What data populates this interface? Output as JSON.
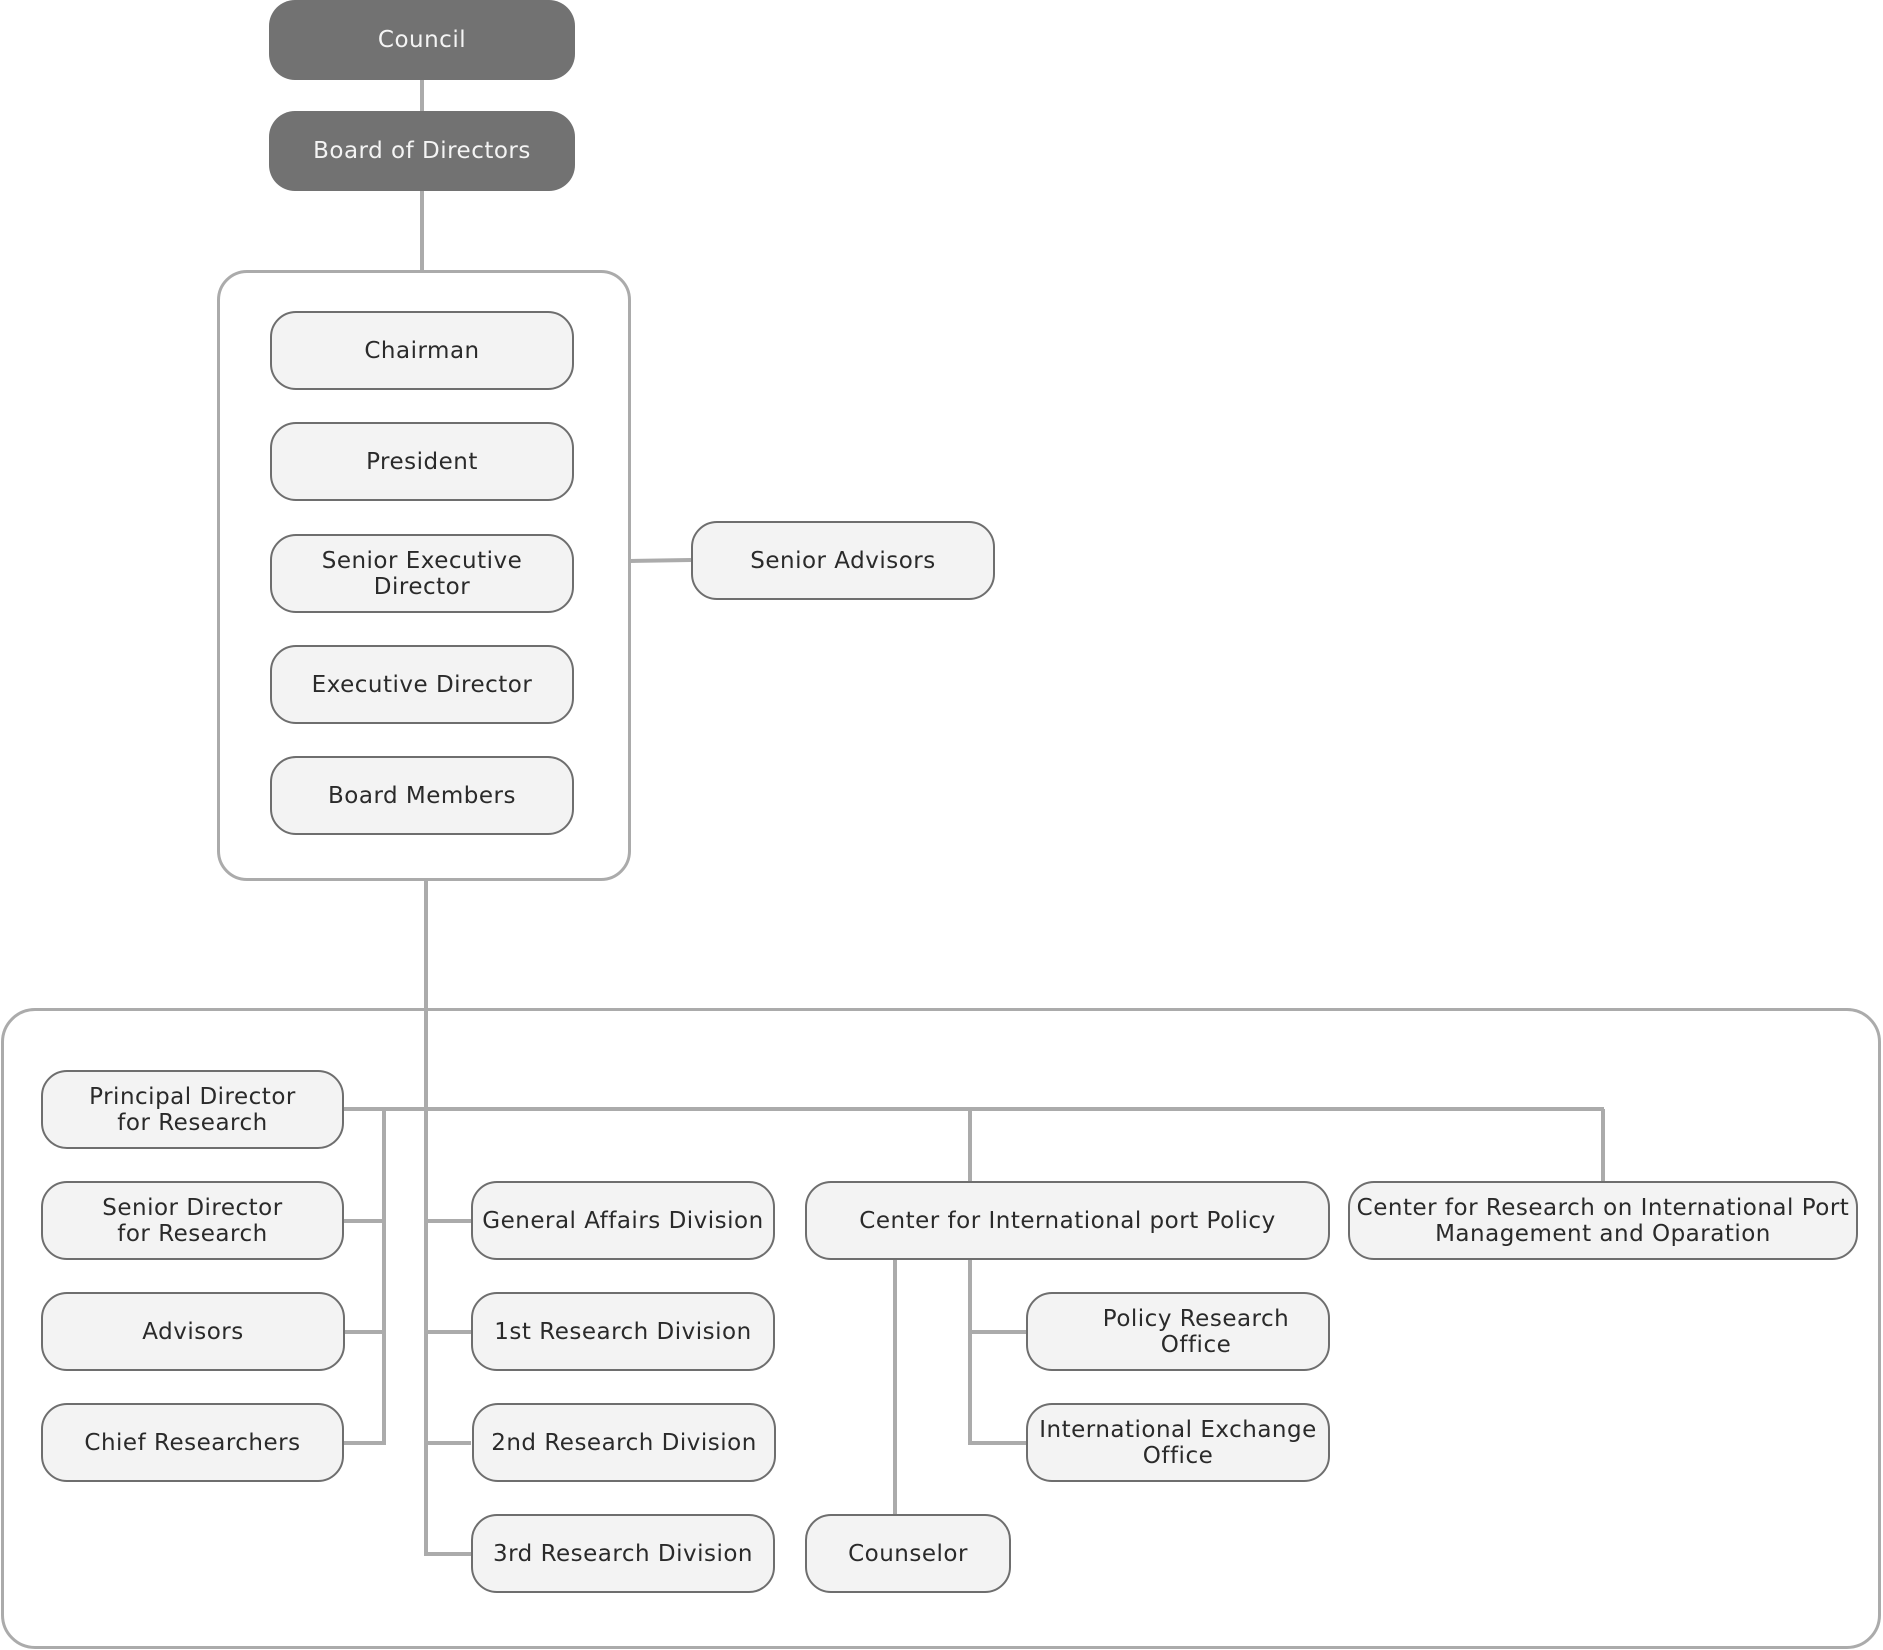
{
  "diagram": {
    "type": "organization-chart",
    "colors": {
      "top_node_fill": "#727272",
      "top_node_text": "#f4f4f4",
      "node_fill": "#f3f3f3",
      "node_border": "#6e6e6e",
      "connector": "#ababab",
      "text": "#2a2a2a"
    },
    "governance": {
      "council": "Council",
      "board_of_directors": "Board of Directors"
    },
    "executives": [
      "Chairman",
      "President",
      "Senior Executive Director",
      "Executive Director",
      "Board Members"
    ],
    "senior_advisors": "Senior Advisors",
    "research_leadership": [
      "Principal Director\nfor Research",
      "Senior Director\nfor Research",
      "Advisors",
      "Chief Researchers"
    ],
    "divisions": [
      "General Affairs Division",
      "1st Research Division",
      "2nd Research Division",
      "3rd Research Division"
    ],
    "center_policy": {
      "name": "Center for International port Policy",
      "offices": [
        "Policy Research Office",
        "International Exchange\nOffice"
      ],
      "counselor": "Counselor"
    },
    "center_research": "Center for Research on International Port\nManagement and Oparation"
  }
}
